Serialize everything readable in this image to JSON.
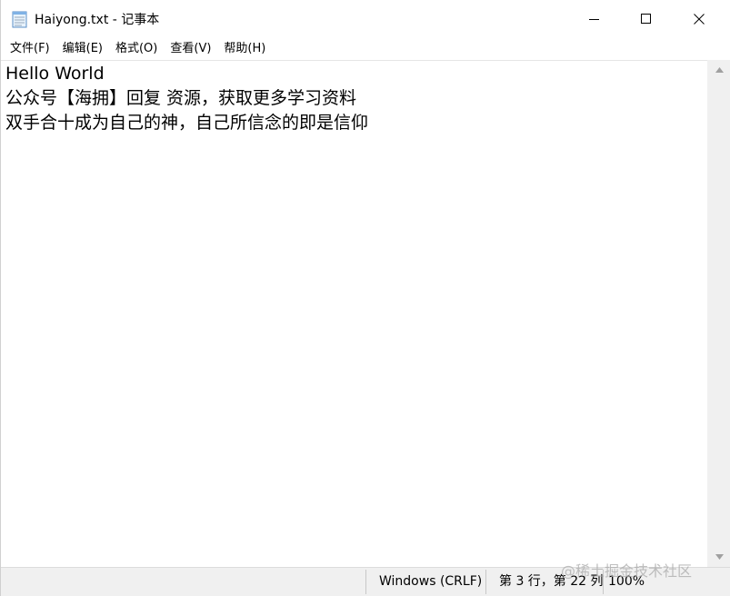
{
  "window": {
    "title": "Haiyong.txt - 记事本"
  },
  "menu": {
    "items": [
      "文件(F)",
      "编辑(E)",
      "格式(O)",
      "查看(V)",
      "帮助(H)"
    ]
  },
  "editor": {
    "lines": [
      "Hello World",
      "公众号【海拥】回复 资源，获取更多学习资料",
      "双手合十成为自己的神，自己所信念的即是信仰"
    ]
  },
  "status": {
    "encoding": "Windows (CRLF)",
    "position": "第 3 行，第 22 列",
    "zoom": "100%"
  },
  "watermark": "@稀土掘金技术社区",
  "colors": {
    "background": "#ffffff",
    "statusbar": "#f0f0f0",
    "text": "#000000"
  },
  "icons": {
    "app": "notepad-icon",
    "minimize": "minimize-icon",
    "maximize": "maximize-icon",
    "close": "close-icon"
  }
}
